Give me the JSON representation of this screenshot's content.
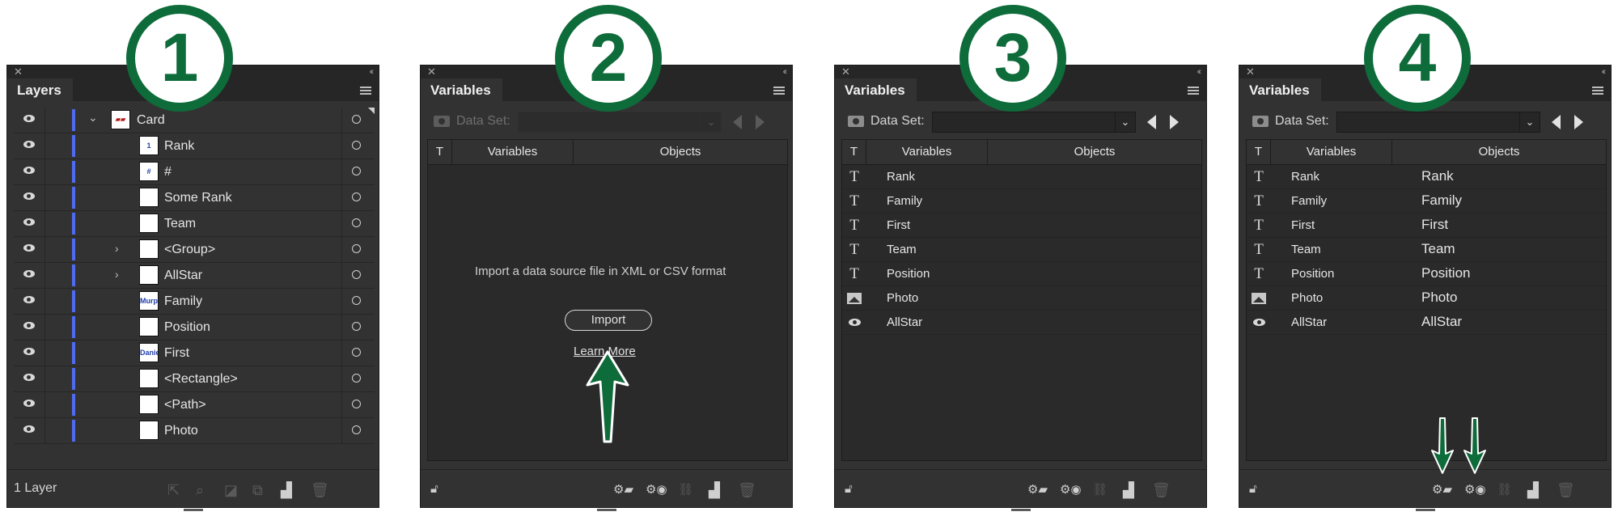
{
  "layers_panel": {
    "tab": "Layers",
    "top_layer": "Card",
    "rows": [
      {
        "name": "Rank",
        "thumb": "1",
        "expand": false
      },
      {
        "name": "#",
        "thumb": "#",
        "expand": false
      },
      {
        "name": "Some Rank",
        "thumb": "",
        "expand": false
      },
      {
        "name": "Team",
        "thumb": "",
        "expand": false
      },
      {
        "name": "<Group>",
        "thumb": "",
        "expand": true
      },
      {
        "name": "AllStar",
        "thumb": "",
        "expand": true
      },
      {
        "name": "Family",
        "thumb": "Murphy",
        "expand": false
      },
      {
        "name": "Position",
        "thumb": "",
        "expand": false
      },
      {
        "name": "First",
        "thumb": "Daniel",
        "expand": false
      },
      {
        "name": "<Rectangle>",
        "thumb": "",
        "expand": false
      },
      {
        "name": "<Path>",
        "thumb": "",
        "expand": false
      },
      {
        "name": "Photo",
        "thumb": "",
        "expand": false
      }
    ],
    "footer": "1 Layer"
  },
  "variables_panel": {
    "tab": "Variables",
    "data_set_label": "Data Set:",
    "col_type": "T",
    "col_variables": "Variables",
    "col_objects": "Objects",
    "empty_message": "Import a data source file in XML or CSV format",
    "import_button": "Import",
    "learn_more": "Learn More"
  },
  "variables": [
    {
      "name": "Rank",
      "type": "text",
      "object": "Rank"
    },
    {
      "name": "Family",
      "type": "text",
      "object": "Family"
    },
    {
      "name": "First",
      "type": "text",
      "object": "First"
    },
    {
      "name": "Team",
      "type": "text",
      "object": "Team"
    },
    {
      "name": "Position",
      "type": "text",
      "object": "Position"
    },
    {
      "name": "Photo",
      "type": "image",
      "object": "Photo"
    },
    {
      "name": "AllStar",
      "type": "visibility",
      "object": "AllStar"
    }
  ],
  "steps": [
    "1",
    "2",
    "3",
    "4"
  ],
  "colors": {
    "badge_green": "#0e6b3a",
    "panel_bg": "#323232",
    "layer_color": "#4f6bf0"
  }
}
